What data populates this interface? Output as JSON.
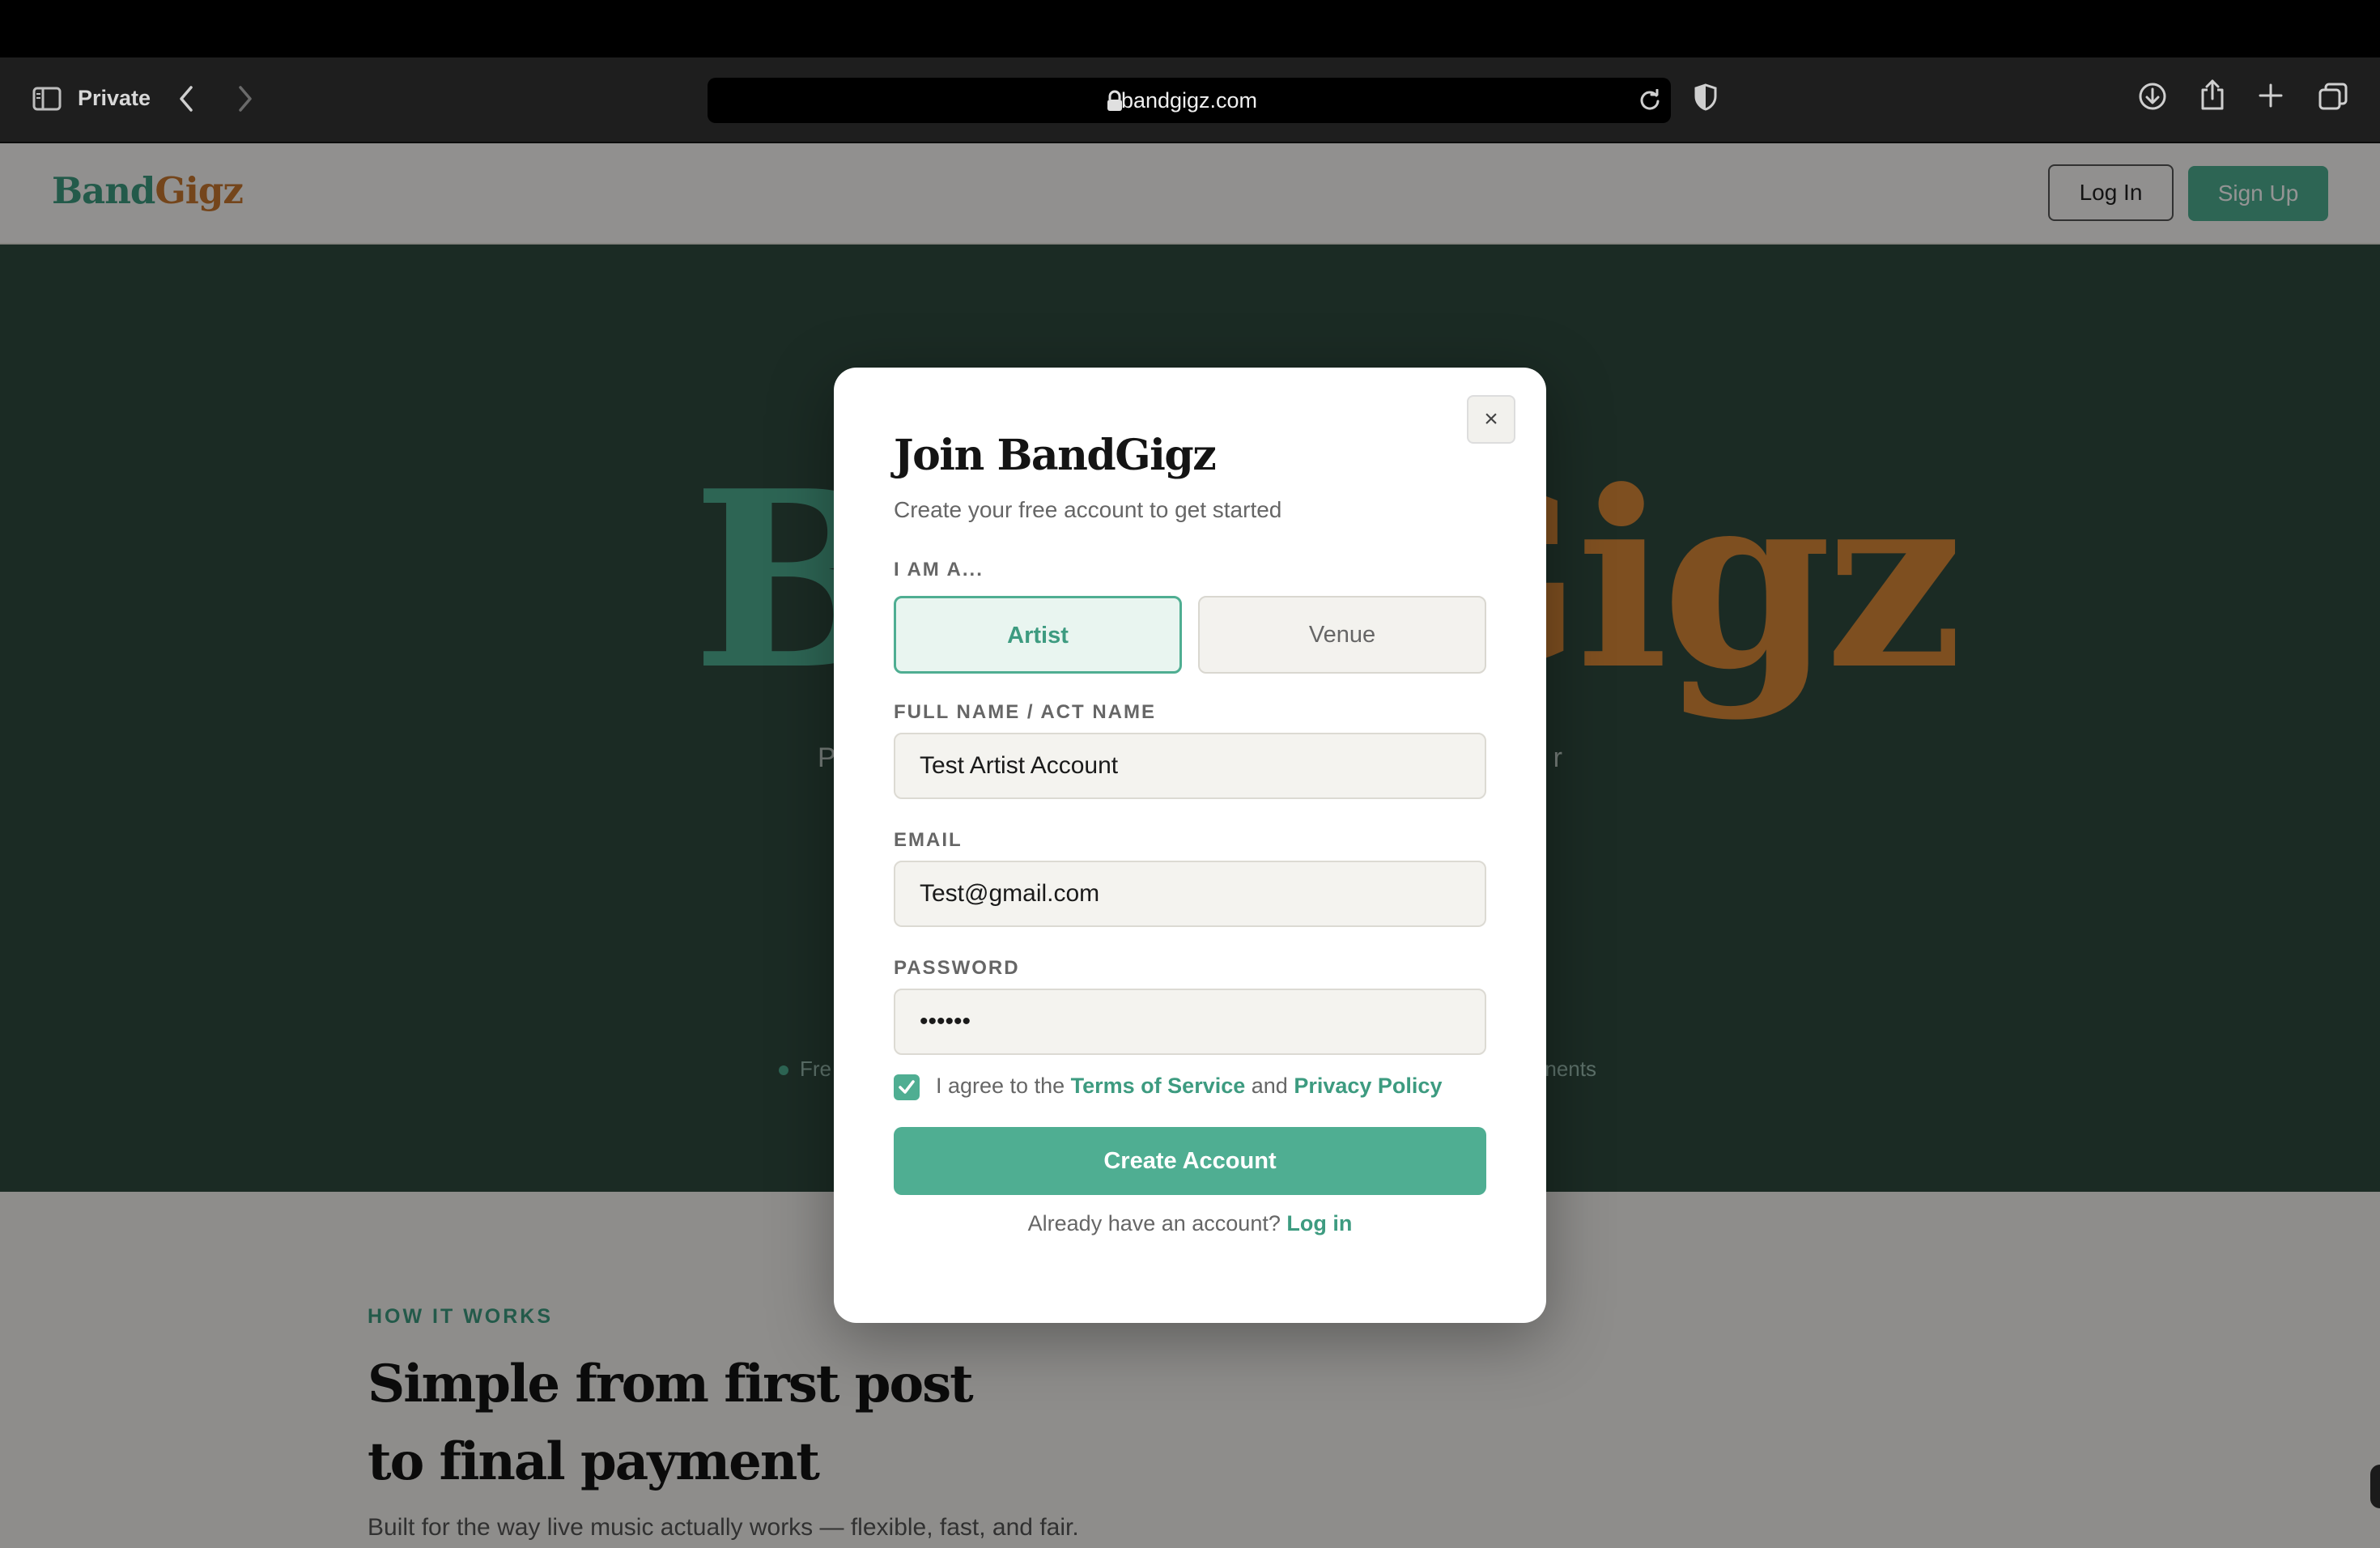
{
  "browser": {
    "private_label": "Private",
    "url": "bandgigz.com"
  },
  "site": {
    "logo_part1": "Band",
    "logo_part2": "Gigz",
    "nav_login": "Log In",
    "nav_signup": "Sign Up"
  },
  "hero": {
    "brand_part1": "Band",
    "brand_part2": "Gigz",
    "tagline_left": "P",
    "tagline_right": "r",
    "feature_left": "Fre",
    "feature_right": "nents"
  },
  "how_it_works": {
    "kicker": "HOW IT WORKS",
    "title_line1": "Simple from first post",
    "title_line2": "to final payment",
    "subtitle": "Built for the way live music actually works — flexible, fast, and fair."
  },
  "modal": {
    "close_glyph": "×",
    "title": "Join BandGigz",
    "subtitle": "Create your free account to get started",
    "role_label": "I AM A...",
    "role_options": [
      "Artist",
      "Venue"
    ],
    "selected_role": "Artist",
    "name_label": "FULL NAME / ACT NAME",
    "name_value": "Test Artist Account",
    "email_label": "EMAIL",
    "email_value": "Test@gmail.com",
    "password_label": "PASSWORD",
    "password_value": "••••••",
    "agree_prefix": "I agree to the",
    "terms_link": "Terms of Service",
    "agree_and": "and",
    "privacy_link": "Privacy Policy",
    "agree_checked": true,
    "create_button": "Create Account",
    "footer_prefix": "Already have an account?",
    "footer_link": "Log in"
  },
  "colors": {
    "accent_green": "#4fae92",
    "accent_orange": "#c9782f",
    "hero_bg": "#2f4a3e"
  }
}
